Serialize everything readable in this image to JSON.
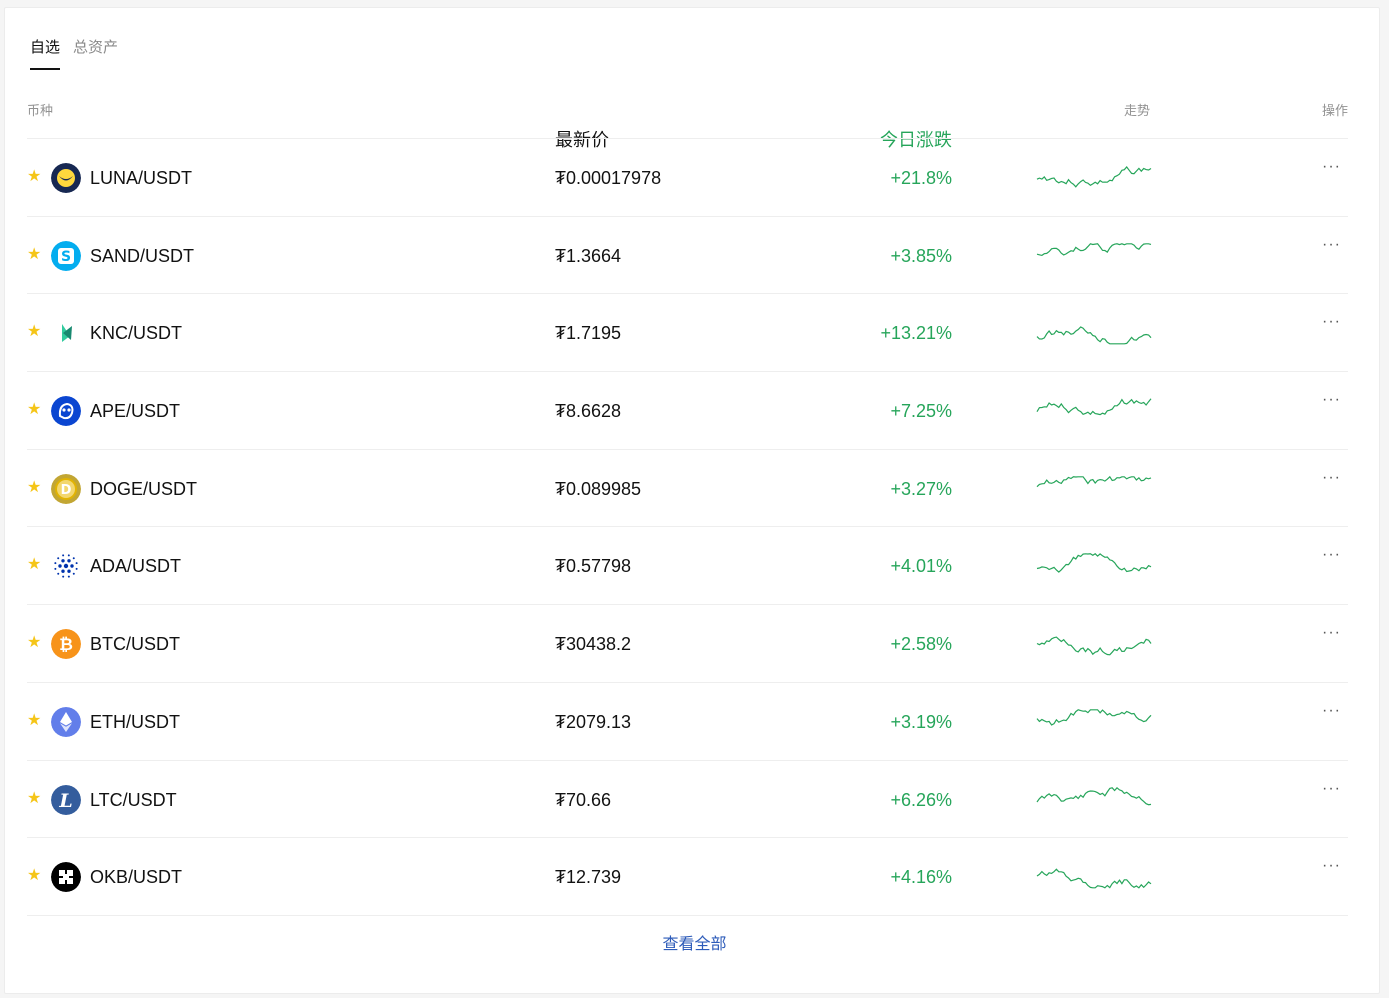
{
  "tabs": [
    {
      "label": "自选",
      "active": true
    },
    {
      "label": "总资产",
      "active": false
    }
  ],
  "columns": {
    "coin": "币种",
    "price": "最新价",
    "change": "今日涨跌",
    "trend": "走势",
    "ops": "操作"
  },
  "rows": [
    {
      "pair": "LUNA/USDT",
      "price": "₮0.00017978",
      "change": "+21.8%",
      "icon": "luna-icon",
      "icon_color": "#172852"
    },
    {
      "pair": "SAND/USDT",
      "price": "₮1.3664",
      "change": "+3.85%",
      "icon": "sand-icon",
      "icon_color": "#04adef"
    },
    {
      "pair": "KNC/USDT",
      "price": "₮1.7195",
      "change": "+13.21%",
      "icon": "knc-icon",
      "icon_color": "#31cb9e"
    },
    {
      "pair": "APE/USDT",
      "price": "₮8.6628",
      "change": "+7.25%",
      "icon": "ape-icon",
      "icon_color": "#0b46d1"
    },
    {
      "pair": "DOGE/USDT",
      "price": "₮0.089985",
      "change": "+3.27%",
      "icon": "doge-icon",
      "icon_color": "#c2a633"
    },
    {
      "pair": "ADA/USDT",
      "price": "₮0.57798",
      "change": "+4.01%",
      "icon": "ada-icon",
      "icon_color": "#0033ad"
    },
    {
      "pair": "BTC/USDT",
      "price": "₮30438.2",
      "change": "+2.58%",
      "icon": "btc-icon",
      "icon_color": "#f7931a"
    },
    {
      "pair": "ETH/USDT",
      "price": "₮2079.13",
      "change": "+3.19%",
      "icon": "eth-icon",
      "icon_color": "#627eea"
    },
    {
      "pair": "LTC/USDT",
      "price": "₮70.66",
      "change": "+6.26%",
      "icon": "ltc-icon",
      "icon_color": "#345d9d"
    },
    {
      "pair": "OKB/USDT",
      "price": "₮12.739",
      "change": "+4.16%",
      "icon": "okb-icon",
      "icon_color": "#000000"
    }
  ],
  "more_label": "···",
  "view_all": "查看全部",
  "colors": {
    "up": "#26a55a",
    "star": "#f5c518",
    "link": "#2d5bb9"
  }
}
